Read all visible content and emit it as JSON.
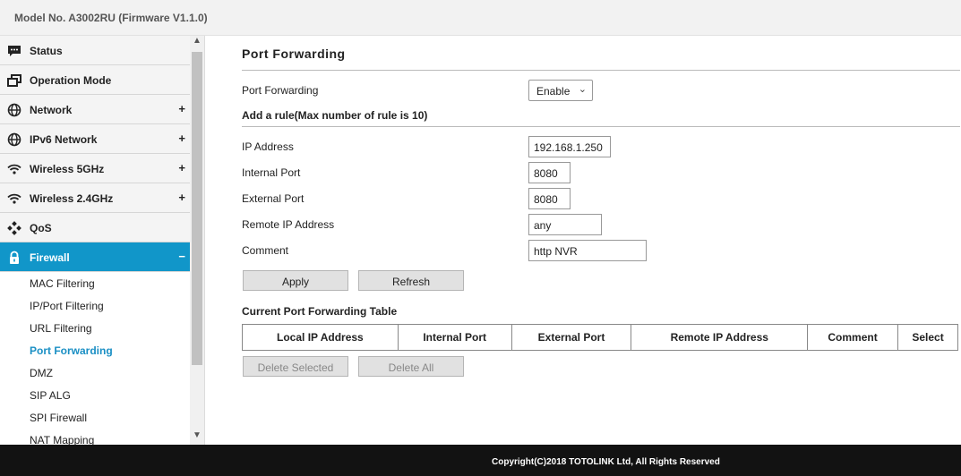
{
  "header": {
    "model": "Model No. A3002RU (Firmware V1.1.0)"
  },
  "sidebar": {
    "items": [
      {
        "label": "Status",
        "icon": "chat-icon",
        "expand": ""
      },
      {
        "label": "Operation Mode",
        "icon": "windows-icon",
        "expand": ""
      },
      {
        "label": "Network",
        "icon": "globe-icon",
        "expand": "+"
      },
      {
        "label": "IPv6 Network",
        "icon": "globe-icon",
        "expand": "+"
      },
      {
        "label": "Wireless 5GHz",
        "icon": "wifi-icon",
        "expand": "+"
      },
      {
        "label": "Wireless 2.4GHz",
        "icon": "wifi-icon",
        "expand": "+"
      },
      {
        "label": "QoS",
        "icon": "qos-icon",
        "expand": ""
      },
      {
        "label": "Firewall",
        "icon": "lock-icon",
        "expand": "−"
      }
    ],
    "firewall_sub": [
      "MAC Filtering",
      "IP/Port Filtering",
      "URL Filtering",
      "Port Forwarding",
      "DMZ",
      "SIP ALG",
      "SPI Firewall",
      "NAT Mapping"
    ],
    "active_color": "#1196c9"
  },
  "page": {
    "title": "Port Forwarding",
    "enable_label": "Port Forwarding",
    "enable_value": "Enable",
    "add_rule_heading": "Add a rule(Max number of rule is 10)",
    "fields": {
      "ip_label": "IP Address",
      "ip_value": "192.168.1.250",
      "internal_label": "Internal Port",
      "internal_value": "8080",
      "external_label": "External Port",
      "external_value": "8080",
      "remote_label": "Remote IP Address",
      "remote_value": "any",
      "comment_label": "Comment",
      "comment_value": "http NVR"
    },
    "apply_label": "Apply",
    "refresh_label": "Refresh",
    "table_heading": "Current Port Forwarding Table",
    "table_columns": [
      "Local IP Address",
      "Internal Port",
      "External Port",
      "Remote IP Address",
      "Comment",
      "Select"
    ],
    "delete_selected_label": "Delete Selected",
    "delete_all_label": "Delete All"
  },
  "footer": {
    "copyright": "Copyright(C)2018 TOTOLINK Ltd, All Rights Reserved"
  }
}
